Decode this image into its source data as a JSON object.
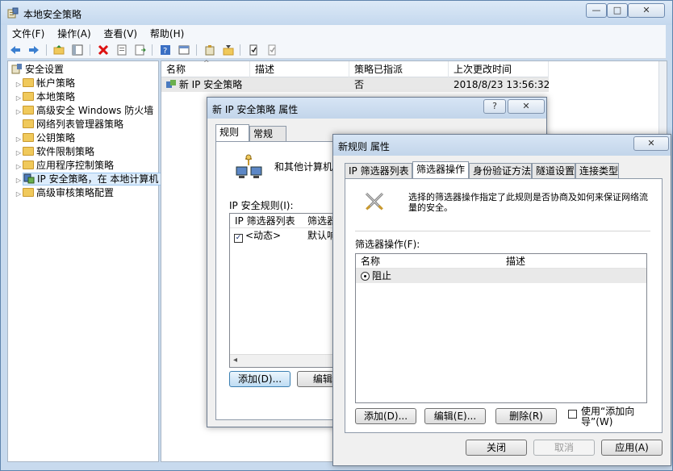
{
  "main_window": {
    "title": "本地安全策略",
    "controls": {
      "minimize": "—",
      "maximize": "□",
      "close": "✕"
    },
    "menu": [
      "文件(F)",
      "操作(A)",
      "查看(V)",
      "帮助(H)"
    ]
  },
  "tree": {
    "items": [
      {
        "label": "安全设置",
        "arrow": ""
      },
      {
        "label": "帐户策略",
        "arrow": "▷"
      },
      {
        "label": "本地策略",
        "arrow": "▷"
      },
      {
        "label": "高级安全 Windows 防火墙",
        "arrow": "▷"
      },
      {
        "label": "网络列表管理器策略",
        "arrow": ""
      },
      {
        "label": "公钥策略",
        "arrow": "▷"
      },
      {
        "label": "软件限制策略",
        "arrow": "▷"
      },
      {
        "label": "应用程序控制策略",
        "arrow": "▷"
      },
      {
        "label": "IP 安全策略，在 本地计算机",
        "arrow": "▷"
      },
      {
        "label": "高级审核策略配置",
        "arrow": "▷"
      }
    ]
  },
  "list": {
    "columns": [
      "名称",
      "描述",
      "策略已指派",
      "上次更改时间"
    ],
    "sort_indicator": "^",
    "rows": [
      {
        "name": "新 IP 安全策略",
        "desc": "",
        "assigned": "否",
        "modified": "2018/8/23 13:56:32"
      }
    ]
  },
  "dialog1": {
    "title": "新 IP 安全策略 属性",
    "help": "?",
    "close": "✕",
    "tabs": [
      "规则",
      "常规"
    ],
    "description": "和其他计算机通",
    "rules_label": "IP 安全规则(I):",
    "rules_columns": [
      "IP 筛选器列表",
      "筛选器"
    ],
    "rules_rows": [
      {
        "check": "✓",
        "filter": "<动态>",
        "action": "默认响"
      }
    ],
    "scroll_left": "◂",
    "add_button": "添加(D)...",
    "edit_button": "编辑(E"
  },
  "dialog2": {
    "title": "新规则 属性",
    "close": "✕",
    "tabs": [
      "IP 筛选器列表",
      "筛选器操作",
      "身份验证方法",
      "隧道设置",
      "连接类型"
    ],
    "description": "选择的筛选器操作指定了此规则是否协商及如何来保证网络流量的安全。",
    "actions_label": "筛选器操作(F):",
    "columns": [
      "名称",
      "描述"
    ],
    "rows": [
      {
        "name": "阻止",
        "desc": ""
      }
    ],
    "add_button": "添加(D)...",
    "edit_button": "编辑(E)...",
    "delete_button": "删除(R)",
    "wizard_checkbox": "使用“添加向导”(W)",
    "ok_button": "关闭",
    "cancel_button": "取消",
    "apply_button": "应用(A)"
  }
}
